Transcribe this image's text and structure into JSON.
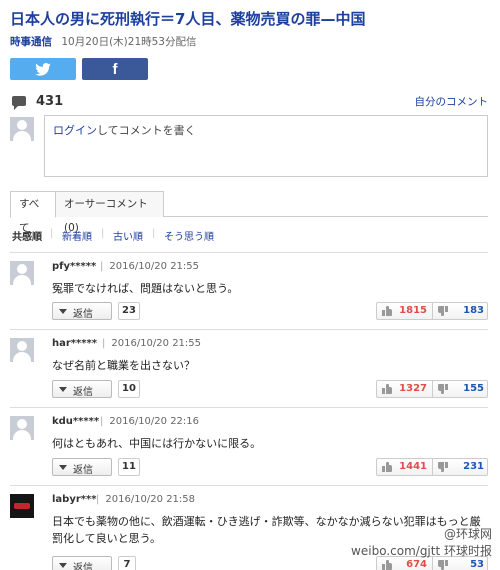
{
  "article": {
    "title": "日本人の男に死刑執行＝7人目、薬物売買の罪—中国",
    "source": "時事通信",
    "datetime": "10月20日(木)21時53分配信"
  },
  "share": {
    "twitter_icon": "twitter-bird-icon",
    "facebook_icon": "facebook-f-icon",
    "facebook_glyph": "f"
  },
  "comments_header": {
    "icon": "comment-bubble-icon",
    "count": "431",
    "my_comments_link": "自分のコメント"
  },
  "post": {
    "login_link": "ログイン",
    "prompt_rest": "してコメントを書く"
  },
  "tabs": [
    {
      "label": "すべて"
    },
    {
      "label": "オーサーコメント(0)"
    }
  ],
  "sort": {
    "active": "共感順",
    "options": [
      "新着順",
      "古い順",
      "そう思う順"
    ],
    "separator": "|"
  },
  "comments": [
    {
      "user": "pfy*****",
      "date": "2016/10/20 21:55",
      "text": "冤罪でなければ、問題はないと思う。",
      "reply_label": "返信",
      "reply_count": "23",
      "agree": "1815",
      "disagree": "183"
    },
    {
      "user": "har*****",
      "date": "2016/10/20 21:55",
      "text": "なぜ名前と職業を出さない？",
      "reply_label": "返信",
      "reply_count": "10",
      "agree": "1327",
      "disagree": "155"
    },
    {
      "user": "kdu*****",
      "date": "2016/10/20 22:16",
      "text": "何はともあれ、中国には行かないに限る。",
      "reply_label": "返信",
      "reply_count": "11",
      "agree": "1441",
      "disagree": "231"
    },
    {
      "user": "labyr***",
      "date": "2016/10/20 21:58",
      "text": "日本でも薬物の他に、飲酒運転・ひき逃げ・詐欺等、なかなか減らない犯罪はもっと厳罰化して良いと思う。",
      "reply_label": "返信",
      "reply_count": "7",
      "agree": "674",
      "disagree": "53"
    }
  ],
  "watermark": {
    "line1": "@环球网",
    "line2": "weibo.com/gjtt 环球时报"
  }
}
